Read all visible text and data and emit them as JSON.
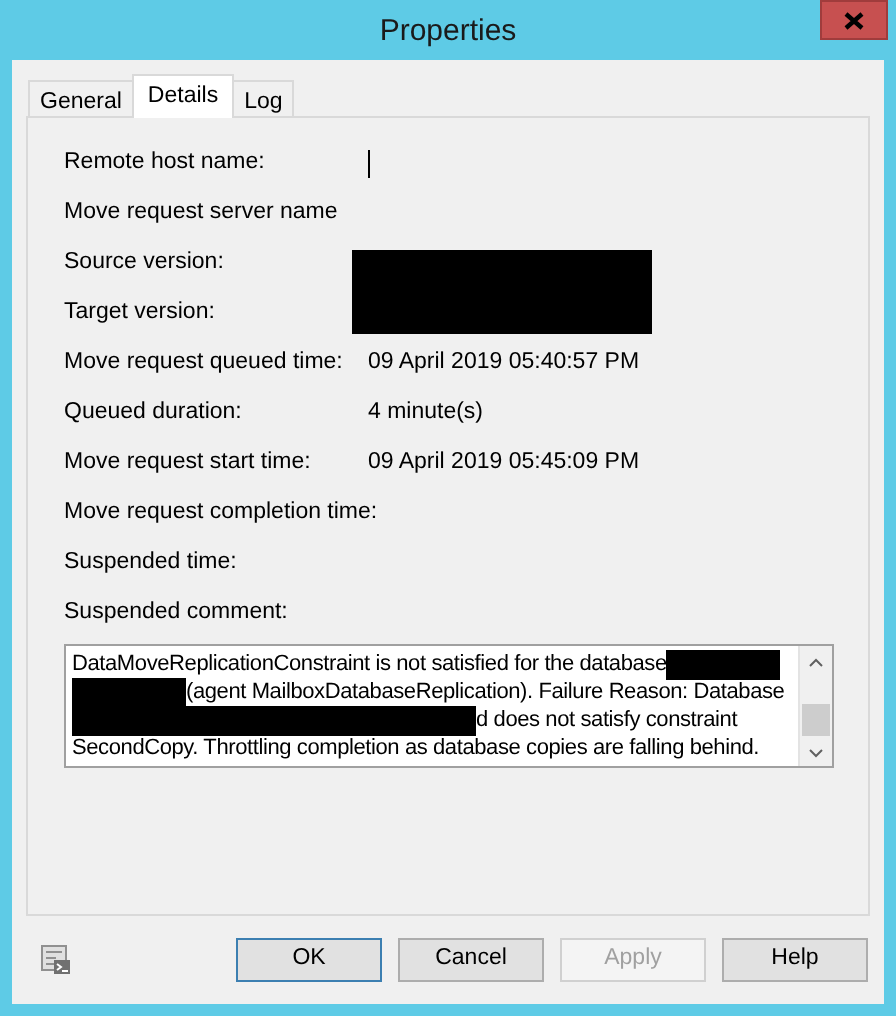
{
  "window": {
    "title": "Properties"
  },
  "tabs": [
    {
      "label": "General",
      "selected": false
    },
    {
      "label": "Details",
      "selected": true
    },
    {
      "label": "Log",
      "selected": false
    }
  ],
  "fields": [
    {
      "label": "Remote host name:",
      "kind": "cursor"
    },
    {
      "label": "Move request server name",
      "kind": "empty"
    },
    {
      "label": "Source version:",
      "kind": "redacted"
    },
    {
      "label": "Target version:",
      "kind": "empty"
    },
    {
      "label": "Move request queued time:",
      "kind": "text",
      "value": "09 April 2019 05:40:57 PM"
    },
    {
      "label": "Queued duration:",
      "kind": "text",
      "value": "4 minute(s)"
    },
    {
      "label": "Move request start time:",
      "kind": "text",
      "value": "09 April 2019 05:45:09 PM"
    },
    {
      "label": "Move request completion time:",
      "kind": "empty"
    },
    {
      "label": "Suspended time:",
      "kind": "empty"
    },
    {
      "label": "Suspended comment:",
      "kind": "empty"
    }
  ],
  "comment": {
    "lines": [
      [
        {
          "kind": "text",
          "text": "DataMoveReplicationConstraint is not satisfied for the database"
        },
        {
          "kind": "mask"
        }
      ],
      [
        {
          "kind": "mask"
        },
        {
          "kind": "text",
          "text": "(agent MailboxDatabaseReplication). Failure Reason: Database"
        }
      ],
      [
        {
          "kind": "longmask"
        },
        {
          "kind": "text",
          "text": "d does not satisfy constraint"
        }
      ],
      [
        {
          "kind": "text",
          "text": "SecondCopy. Throttling completion as database copies are falling behind."
        }
      ]
    ]
  },
  "buttons": [
    {
      "label": "OK",
      "default": true,
      "disabled": false
    },
    {
      "label": "Cancel",
      "default": false,
      "disabled": false
    },
    {
      "label": "Apply",
      "default": false,
      "disabled": true
    },
    {
      "label": "Help",
      "default": false,
      "disabled": false
    }
  ]
}
